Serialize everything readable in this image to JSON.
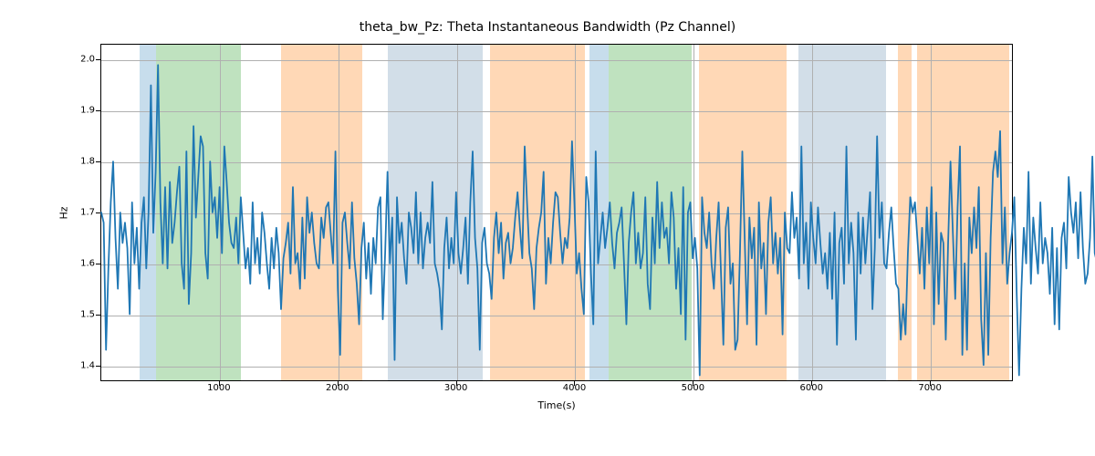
{
  "chart_data": {
    "type": "line",
    "title": "theta_bw_Pz: Theta Instantaneous Bandwidth (Pz Channel)",
    "xlabel": "Time(s)",
    "ylabel": "Hz",
    "xlim": [
      0,
      7700
    ],
    "ylim": [
      1.37,
      2.03
    ],
    "xticks": [
      1000,
      2000,
      3000,
      4000,
      5000,
      6000,
      7000
    ],
    "yticks": [
      1.4,
      1.5,
      1.6,
      1.7,
      1.8,
      1.9,
      2.0
    ],
    "line_color": "#1f77b4",
    "grid": true,
    "shaded_regions": [
      {
        "x0": 320,
        "x1": 460,
        "color": "blue"
      },
      {
        "x0": 460,
        "x1": 1180,
        "color": "green"
      },
      {
        "x0": 1520,
        "x1": 2200,
        "color": "orange"
      },
      {
        "x0": 2420,
        "x1": 3110,
        "color": "lblue"
      },
      {
        "x0": 3110,
        "x1": 3220,
        "color": "lblue"
      },
      {
        "x0": 3280,
        "x1": 4080,
        "color": "orange"
      },
      {
        "x0": 4120,
        "x1": 4280,
        "color": "blue"
      },
      {
        "x0": 4280,
        "x1": 4980,
        "color": "green"
      },
      {
        "x0": 5040,
        "x1": 5780,
        "color": "orange"
      },
      {
        "x0": 5880,
        "x1": 6520,
        "color": "lblue"
      },
      {
        "x0": 6520,
        "x1": 6620,
        "color": "lblue"
      },
      {
        "x0": 6720,
        "x1": 6840,
        "color": "orange"
      },
      {
        "x0": 6880,
        "x1": 7660,
        "color": "orange"
      }
    ],
    "series": [
      {
        "name": "theta_bw_Pz",
        "x_start": 0,
        "x_step": 20,
        "values": [
          1.7,
          1.68,
          1.43,
          1.59,
          1.72,
          1.8,
          1.65,
          1.55,
          1.7,
          1.64,
          1.68,
          1.63,
          1.5,
          1.72,
          1.6,
          1.67,
          1.55,
          1.68,
          1.73,
          1.59,
          1.7,
          1.95,
          1.66,
          1.78,
          1.99,
          1.72,
          1.6,
          1.75,
          1.59,
          1.76,
          1.64,
          1.68,
          1.74,
          1.79,
          1.6,
          1.55,
          1.82,
          1.52,
          1.62,
          1.87,
          1.69,
          1.77,
          1.85,
          1.83,
          1.62,
          1.57,
          1.8,
          1.7,
          1.73,
          1.65,
          1.75,
          1.62,
          1.83,
          1.76,
          1.68,
          1.64,
          1.63,
          1.69,
          1.6,
          1.73,
          1.66,
          1.59,
          1.63,
          1.56,
          1.72,
          1.6,
          1.65,
          1.58,
          1.7,
          1.66,
          1.6,
          1.55,
          1.65,
          1.59,
          1.67,
          1.62,
          1.51,
          1.61,
          1.64,
          1.68,
          1.58,
          1.75,
          1.6,
          1.62,
          1.55,
          1.69,
          1.57,
          1.73,
          1.66,
          1.7,
          1.64,
          1.6,
          1.59,
          1.69,
          1.65,
          1.71,
          1.72,
          1.66,
          1.6,
          1.82,
          1.55,
          1.42,
          1.68,
          1.7,
          1.64,
          1.59,
          1.72,
          1.61,
          1.56,
          1.48,
          1.63,
          1.68,
          1.57,
          1.64,
          1.54,
          1.65,
          1.6,
          1.71,
          1.73,
          1.49,
          1.62,
          1.78,
          1.6,
          1.69,
          1.41,
          1.73,
          1.64,
          1.68,
          1.61,
          1.56,
          1.7,
          1.67,
          1.62,
          1.74,
          1.6,
          1.7,
          1.59,
          1.65,
          1.68,
          1.64,
          1.76,
          1.6,
          1.58,
          1.55,
          1.47,
          1.63,
          1.69,
          1.59,
          1.65,
          1.6,
          1.74,
          1.62,
          1.58,
          1.63,
          1.69,
          1.56,
          1.72,
          1.82,
          1.65,
          1.59,
          1.43,
          1.64,
          1.67,
          1.6,
          1.58,
          1.53,
          1.65,
          1.7,
          1.62,
          1.68,
          1.57,
          1.64,
          1.66,
          1.6,
          1.63,
          1.69,
          1.74,
          1.67,
          1.61,
          1.83,
          1.72,
          1.62,
          1.59,
          1.51,
          1.63,
          1.67,
          1.7,
          1.78,
          1.56,
          1.65,
          1.6,
          1.68,
          1.74,
          1.73,
          1.66,
          1.6,
          1.65,
          1.63,
          1.69,
          1.84,
          1.72,
          1.58,
          1.62,
          1.55,
          1.5,
          1.77,
          1.72,
          1.58,
          1.48,
          1.82,
          1.6,
          1.65,
          1.7,
          1.63,
          1.67,
          1.72,
          1.64,
          1.59,
          1.66,
          1.68,
          1.71,
          1.6,
          1.48,
          1.64,
          1.7,
          1.74,
          1.6,
          1.66,
          1.59,
          1.62,
          1.73,
          1.56,
          1.51,
          1.69,
          1.6,
          1.76,
          1.63,
          1.72,
          1.65,
          1.67,
          1.6,
          1.74,
          1.69,
          1.55,
          1.63,
          1.5,
          1.75,
          1.45,
          1.7,
          1.72,
          1.61,
          1.65,
          1.59,
          1.38,
          1.73,
          1.66,
          1.63,
          1.7,
          1.6,
          1.55,
          1.65,
          1.72,
          1.58,
          1.44,
          1.67,
          1.71,
          1.56,
          1.6,
          1.43,
          1.45,
          1.62,
          1.82,
          1.65,
          1.48,
          1.69,
          1.61,
          1.67,
          1.44,
          1.72,
          1.59,
          1.64,
          1.5,
          1.68,
          1.73,
          1.6,
          1.66,
          1.58,
          1.65,
          1.46,
          1.7,
          1.63,
          1.62,
          1.74,
          1.65,
          1.69,
          1.57,
          1.83,
          1.6,
          1.68,
          1.55,
          1.72,
          1.65,
          1.6,
          1.71,
          1.64,
          1.58,
          1.62,
          1.55,
          1.66,
          1.53,
          1.7,
          1.44,
          1.64,
          1.67,
          1.56,
          1.83,
          1.6,
          1.68,
          1.62,
          1.45,
          1.7,
          1.58,
          1.69,
          1.6,
          1.67,
          1.74,
          1.51,
          1.63,
          1.85,
          1.65,
          1.72,
          1.6,
          1.59,
          1.66,
          1.71,
          1.63,
          1.56,
          1.55,
          1.45,
          1.52,
          1.46,
          1.62,
          1.73,
          1.7,
          1.72,
          1.65,
          1.58,
          1.67,
          1.55,
          1.71,
          1.6,
          1.75,
          1.48,
          1.7,
          1.52,
          1.66,
          1.64,
          1.45,
          1.64,
          1.8,
          1.66,
          1.53,
          1.71,
          1.83,
          1.42,
          1.6,
          1.43,
          1.69,
          1.62,
          1.71,
          1.63,
          1.75,
          1.49,
          1.4,
          1.62,
          1.42,
          1.65,
          1.78,
          1.82,
          1.77,
          1.86,
          1.6,
          1.71,
          1.56,
          1.62,
          1.66,
          1.73,
          1.54,
          1.38,
          1.55,
          1.67,
          1.6,
          1.78,
          1.56,
          1.69,
          1.63,
          1.58,
          1.72,
          1.6,
          1.65,
          1.62,
          1.54,
          1.67,
          1.48,
          1.63,
          1.47,
          1.65,
          1.68,
          1.59,
          1.77,
          1.7,
          1.66,
          1.72,
          1.61,
          1.74,
          1.63,
          1.56,
          1.58,
          1.65,
          1.81,
          1.62,
          1.6
        ]
      }
    ]
  }
}
